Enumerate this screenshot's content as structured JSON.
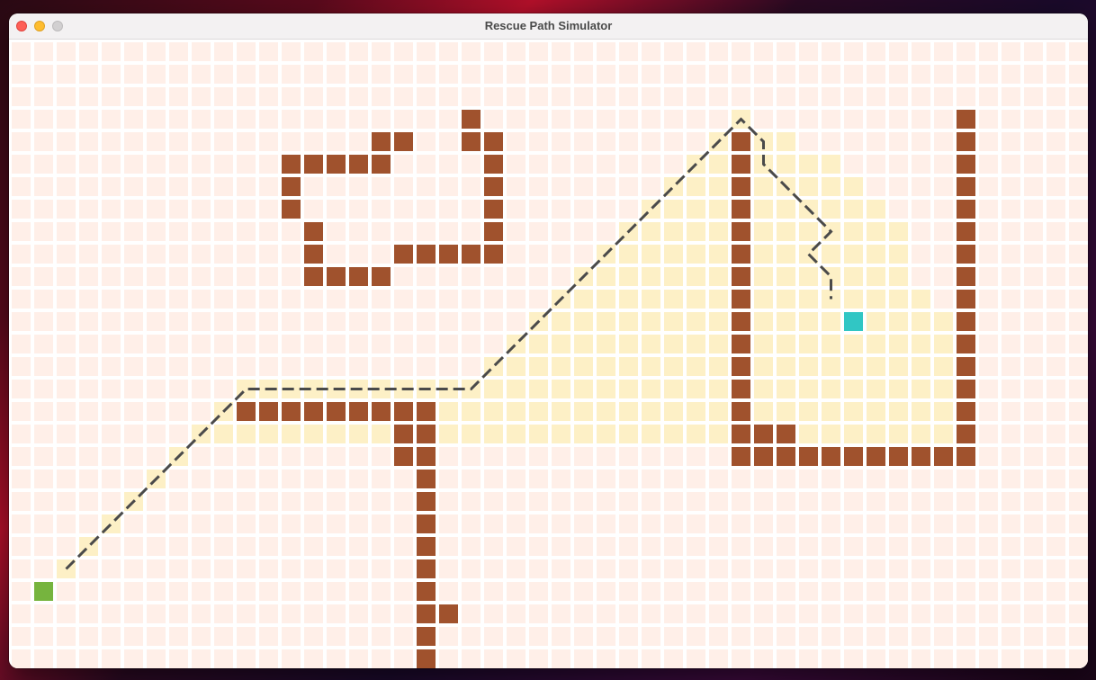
{
  "window": {
    "title": "Rescue Path Simulator"
  },
  "colors": {
    "cell_empty": "#ffefe8",
    "cell_wall": "#a0522d",
    "cell_explored": "#fdf0c6",
    "cell_start": "#76b43e",
    "cell_target": "#31c6c4",
    "path": "#4a4a4a",
    "gap": "#ffffff"
  },
  "grid": {
    "cols": 48,
    "rows": 28,
    "start": [
      1,
      24
    ],
    "target": [
      37,
      12
    ],
    "walls": [
      [
        20,
        3
      ],
      [
        16,
        4
      ],
      [
        17,
        4
      ],
      [
        20,
        4
      ],
      [
        21,
        4
      ],
      [
        12,
        5
      ],
      [
        13,
        5
      ],
      [
        14,
        5
      ],
      [
        15,
        5
      ],
      [
        16,
        5
      ],
      [
        21,
        5
      ],
      [
        12,
        6
      ],
      [
        21,
        6
      ],
      [
        12,
        7
      ],
      [
        21,
        7
      ],
      [
        13,
        8
      ],
      [
        21,
        8
      ],
      [
        13,
        9
      ],
      [
        17,
        9
      ],
      [
        18,
        9
      ],
      [
        19,
        9
      ],
      [
        20,
        9
      ],
      [
        21,
        9
      ],
      [
        13,
        10
      ],
      [
        14,
        10
      ],
      [
        15,
        10
      ],
      [
        16,
        10
      ],
      [
        10,
        16
      ],
      [
        11,
        16
      ],
      [
        12,
        16
      ],
      [
        13,
        16
      ],
      [
        14,
        16
      ],
      [
        15,
        16
      ],
      [
        16,
        16
      ],
      [
        17,
        16
      ],
      [
        18,
        16
      ],
      [
        17,
        17
      ],
      [
        18,
        17
      ],
      [
        17,
        18
      ],
      [
        18,
        18
      ],
      [
        18,
        19
      ],
      [
        18,
        20
      ],
      [
        18,
        21
      ],
      [
        18,
        22
      ],
      [
        18,
        23
      ],
      [
        18,
        24
      ],
      [
        18,
        25
      ],
      [
        19,
        25
      ],
      [
        18,
        26
      ],
      [
        18,
        27
      ],
      [
        32,
        4
      ],
      [
        32,
        5
      ],
      [
        32,
        6
      ],
      [
        32,
        7
      ],
      [
        32,
        8
      ],
      [
        32,
        9
      ],
      [
        32,
        10
      ],
      [
        32,
        11
      ],
      [
        32,
        12
      ],
      [
        32,
        13
      ],
      [
        32,
        14
      ],
      [
        32,
        15
      ],
      [
        32,
        16
      ],
      [
        32,
        17
      ],
      [
        32,
        18
      ],
      [
        33,
        17
      ],
      [
        34,
        17
      ],
      [
        33,
        18
      ],
      [
        34,
        18
      ],
      [
        35,
        18
      ],
      [
        36,
        18
      ],
      [
        37,
        18
      ],
      [
        38,
        18
      ],
      [
        39,
        18
      ],
      [
        40,
        18
      ],
      [
        41,
        18
      ],
      [
        42,
        18
      ],
      [
        42,
        3
      ],
      [
        42,
        4
      ],
      [
        42,
        5
      ],
      [
        42,
        6
      ],
      [
        42,
        7
      ],
      [
        42,
        8
      ],
      [
        42,
        9
      ],
      [
        42,
        10
      ],
      [
        42,
        11
      ],
      [
        42,
        12
      ],
      [
        42,
        13
      ],
      [
        42,
        14
      ],
      [
        42,
        15
      ],
      [
        42,
        16
      ],
      [
        42,
        17
      ]
    ],
    "explored_rows": [
      {
        "row": 3,
        "from": 32,
        "to": 32
      },
      {
        "row": 4,
        "from": 31,
        "to": 34
      },
      {
        "row": 5,
        "from": 30,
        "to": 36
      },
      {
        "row": 6,
        "from": 29,
        "to": 37
      },
      {
        "row": 7,
        "from": 28,
        "to": 38
      },
      {
        "row": 8,
        "from": 27,
        "to": 39
      },
      {
        "row": 9,
        "from": 26,
        "to": 39
      },
      {
        "row": 10,
        "from": 25,
        "to": 39
      },
      {
        "row": 11,
        "from": 24,
        "to": 40
      },
      {
        "row": 12,
        "from": 23,
        "to": 41
      },
      {
        "row": 13,
        "from": 22,
        "to": 41
      },
      {
        "row": 14,
        "from": 21,
        "to": 41
      },
      {
        "row": 15,
        "from": 10,
        "to": 41
      },
      {
        "row": 16,
        "from": 9,
        "to": 41
      },
      {
        "row": 17,
        "from": 8,
        "to": 41
      },
      {
        "row": 18,
        "from": 7,
        "to": 7
      },
      {
        "row": 19,
        "from": 6,
        "to": 6
      },
      {
        "row": 20,
        "from": 5,
        "to": 5
      },
      {
        "row": 21,
        "from": 4,
        "to": 4
      },
      {
        "row": 22,
        "from": 3,
        "to": 3
      },
      {
        "row": 23,
        "from": 2,
        "to": 2
      }
    ],
    "path": [
      [
        2.5,
        23.5
      ],
      [
        10.5,
        15.5
      ],
      [
        20.5,
        15.5
      ],
      [
        32.5,
        3.5
      ],
      [
        33.5,
        4.5
      ],
      [
        33.5,
        5.5
      ],
      [
        36.5,
        8.5
      ],
      [
        35.5,
        9.5
      ],
      [
        36.5,
        10.5
      ],
      [
        36.5,
        11.5
      ]
    ]
  }
}
